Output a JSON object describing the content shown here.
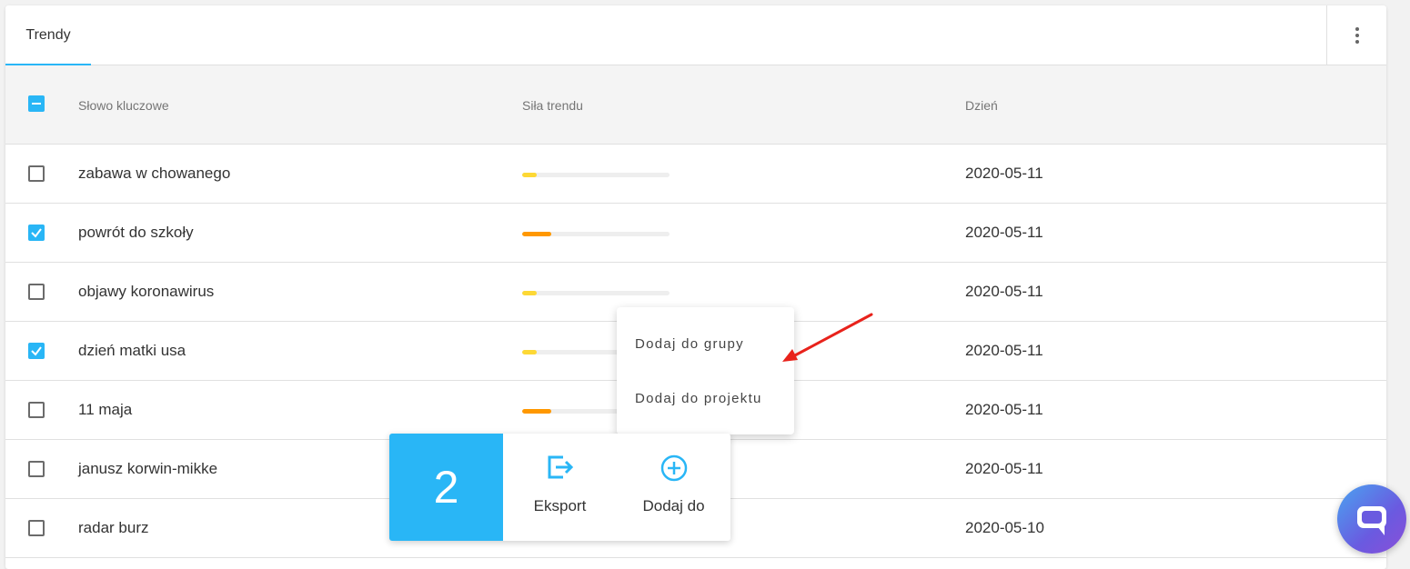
{
  "tab": {
    "label": "Trendy"
  },
  "table": {
    "columns": {
      "keyword": "Słowo kluczowe",
      "strength": "Siła trendu",
      "day": "Dzień"
    },
    "rows": [
      {
        "keyword": "zabawa w chowanego",
        "checked": false,
        "strength": 0.1,
        "color": "#fdd835",
        "day": "2020-05-11"
      },
      {
        "keyword": "powrót do szkoły",
        "checked": true,
        "strength": 0.2,
        "color": "#ff9800",
        "day": "2020-05-11"
      },
      {
        "keyword": "objawy koronawirus",
        "checked": false,
        "strength": 0.1,
        "color": "#fdd835",
        "day": "2020-05-11"
      },
      {
        "keyword": "dzień matki usa",
        "checked": true,
        "strength": 0.1,
        "color": "#fdd835",
        "day": "2020-05-11"
      },
      {
        "keyword": "11 maja",
        "checked": false,
        "strength": 0.2,
        "color": "#ff9800",
        "day": "2020-05-11"
      },
      {
        "keyword": "janusz korwin-mikke",
        "checked": false,
        "strength": 0.1,
        "color": "#fdd835",
        "day": "2020-05-11"
      },
      {
        "keyword": "radar burz",
        "checked": false,
        "strength": 0.1,
        "color": "#fdd835",
        "day": "2020-05-10"
      }
    ]
  },
  "menu": {
    "items": [
      "Dodaj do grupy",
      "Dodaj do projektu"
    ]
  },
  "actions": {
    "selected_count": "2",
    "export_label": "Eksport",
    "add_label": "Dodaj do"
  },
  "colors": {
    "accent": "#29b6f6",
    "arrow": "#e8221b"
  }
}
